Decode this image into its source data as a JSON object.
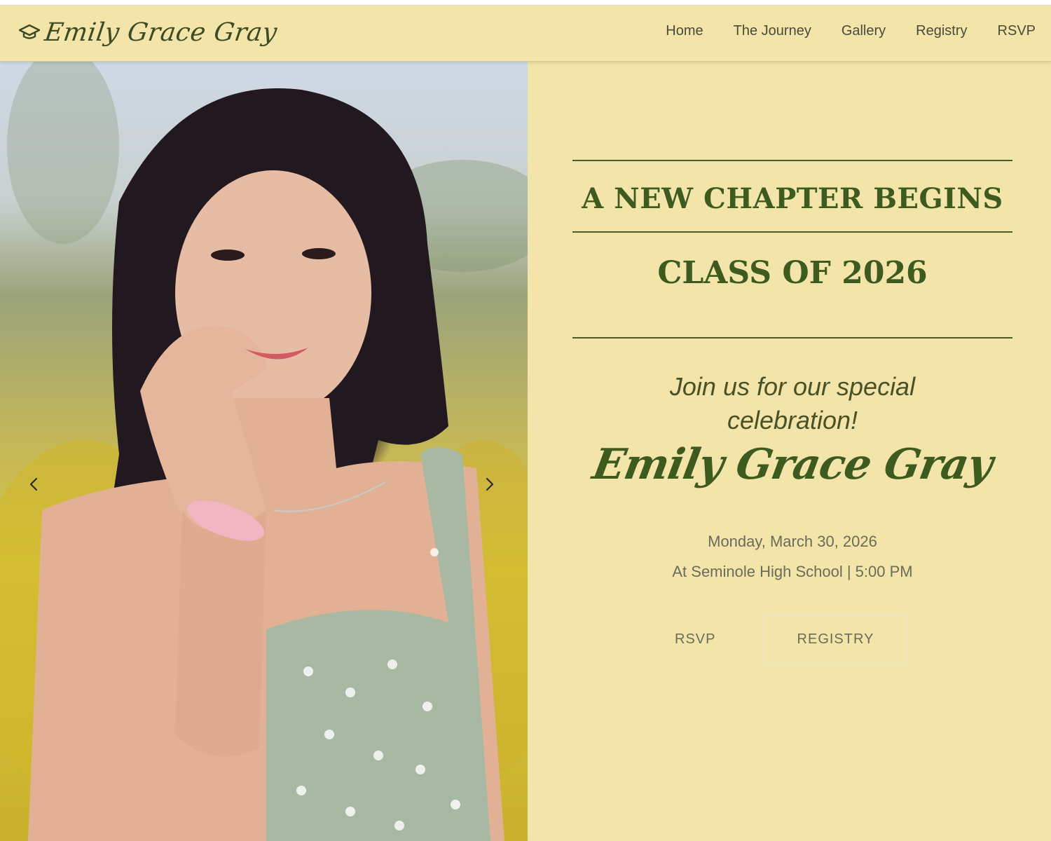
{
  "header": {
    "brand_name": "Emily Grace Gray",
    "brand_icon": "graduation-cap-icon",
    "nav": [
      {
        "label": "Home"
      },
      {
        "label": "The Journey"
      },
      {
        "label": "Gallery"
      },
      {
        "label": "Registry"
      },
      {
        "label": "RSVP"
      }
    ]
  },
  "hero": {
    "photo_description_icon": "photo",
    "prev_icon": "chevron-left-icon",
    "next_icon": "chevron-right-icon"
  },
  "panel": {
    "headline": "A NEW CHAPTER BEGINS",
    "subheadline": "CLASS OF 2026",
    "invite_line1": "Join us for our special",
    "invite_line2": "celebration!",
    "name": "Emily Grace Gray",
    "date": "Monday, March 30, 2026",
    "location": "At Seminole High School | 5:00 PM",
    "rsvp_label": "RSVP",
    "registry_label": "REGISTRY"
  },
  "colors": {
    "background": "#f3e5a9",
    "accent_green": "#3d5a1f",
    "text_gray": "#6b6b5a"
  }
}
